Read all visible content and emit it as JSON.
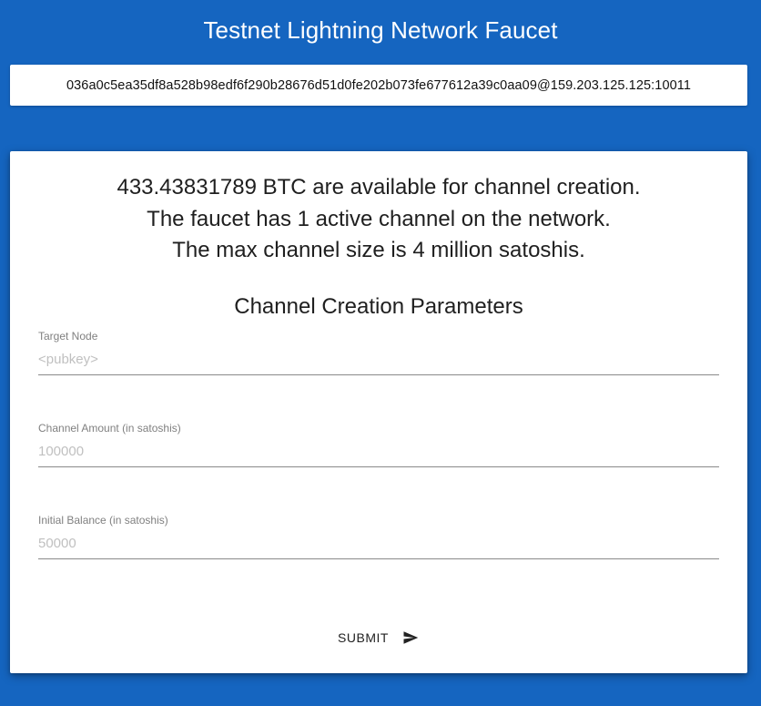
{
  "header": {
    "title": "Testnet Lightning Network Faucet"
  },
  "node_uri": "036a0c5ea35df8a528b98edf6f290b28676d51d0fe202b073fe677612a39c0aa09@159.203.125.125:10011",
  "stats": {
    "available_line": "433.43831789 BTC are available for channel creation.",
    "channels_line": "The faucet has 1 active channel on the network.",
    "max_size_line": "The max channel size is 4 million satoshis."
  },
  "form": {
    "title": "Channel Creation Parameters",
    "target_node": {
      "label": "Target Node",
      "placeholder": "<pubkey>",
      "value": ""
    },
    "channel_amount": {
      "label": "Channel Amount (in satoshis)",
      "placeholder": "100000",
      "value": ""
    },
    "initial_balance": {
      "label": "Initial Balance (in satoshis)",
      "placeholder": "50000",
      "value": ""
    },
    "submit_label": "SUBMIT",
    "submit_icon": "send-icon"
  },
  "colors": {
    "background": "#1565c0",
    "card": "#ffffff",
    "text": "#1f1f1f",
    "label": "#808080",
    "placeholder": "#c0c0c0"
  }
}
